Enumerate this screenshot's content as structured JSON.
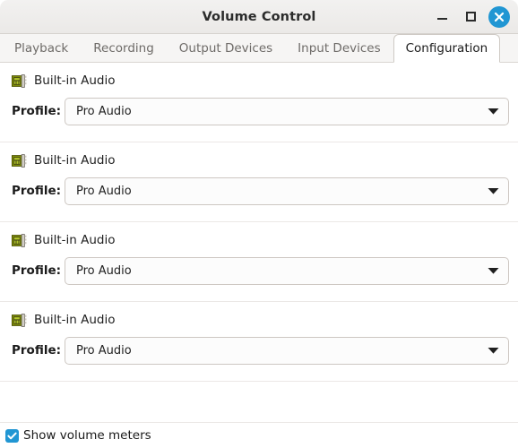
{
  "window": {
    "title": "Volume Control",
    "controls": {
      "minimize": {
        "name": "minimize-button",
        "glyph": "minimize-icon"
      },
      "maximize": {
        "name": "maximize-button",
        "glyph": "maximize-icon"
      },
      "close": {
        "name": "close-button",
        "glyph": "close-icon",
        "color": "#2196d3"
      }
    }
  },
  "tabs": [
    {
      "label": "Playback",
      "active": false
    },
    {
      "label": "Recording",
      "active": false
    },
    {
      "label": "Output Devices",
      "active": false
    },
    {
      "label": "Input Devices",
      "active": false
    },
    {
      "label": "Configuration",
      "active": true
    }
  ],
  "devices": [
    {
      "icon": "sound-card-icon",
      "name": "Built-in Audio",
      "profile_label": "Profile:",
      "profile_value": "Pro Audio"
    },
    {
      "icon": "sound-card-icon",
      "name": "Built-in Audio",
      "profile_label": "Profile:",
      "profile_value": "Pro Audio"
    },
    {
      "icon": "sound-card-icon",
      "name": "Built-in Audio",
      "profile_label": "Profile:",
      "profile_value": "Pro Audio"
    },
    {
      "icon": "sound-card-icon",
      "name": "Built-in Audio",
      "profile_label": "Profile:",
      "profile_value": "Pro Audio"
    }
  ],
  "footer": {
    "show_volume_meters_label": "Show volume meters",
    "show_volume_meters_checked": true,
    "checkbox_color": "#2196d3"
  },
  "colors": {
    "accent": "#2196d3",
    "titlebar_bg": "#efedeb",
    "tabbar_bg": "#f6f5f4",
    "content_bg": "#ffffff",
    "separator": "#ebe8e6",
    "combo_border": "#cdc7c2"
  }
}
